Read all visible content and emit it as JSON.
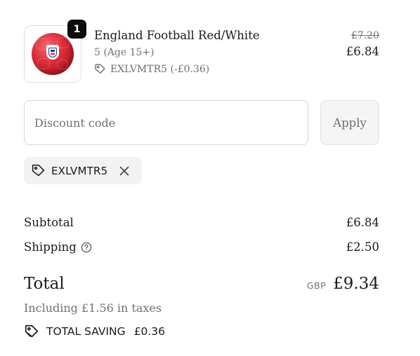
{
  "product": {
    "quantity_badge": "1",
    "name": "England Football Red/White",
    "variant": "5 (Age 15+)",
    "discount_label": "EXLVMTR5 (-£0.36)",
    "original_price": "£7.20",
    "price": "£6.84",
    "image_icon": "england-football-image"
  },
  "discount": {
    "input_placeholder": "Discount code",
    "input_value": "",
    "apply_label": "Apply"
  },
  "applied_code": {
    "code": "EXLVMTR5",
    "tag_icon": "tag-icon",
    "remove_icon": "close-icon"
  },
  "summary": {
    "subtotal_label": "Subtotal",
    "subtotal_value": "£6.84",
    "shipping_label": "Shipping",
    "shipping_info_icon": "question-circle-icon",
    "shipping_value": "£2.50",
    "total_label": "Total",
    "currency": "GBP",
    "total_value": "£9.34",
    "taxes_note": "Including £1.56 in taxes",
    "saving_label": "TOTAL SAVING",
    "saving_value": "£0.36"
  },
  "colors": {
    "text": "#1a1a1a",
    "muted": "#707070",
    "badge_bg": "#0d0d0d",
    "chip_bg": "#f2f2f2",
    "button_bg": "#f5f5f5",
    "ball_red": "#e0303c"
  }
}
